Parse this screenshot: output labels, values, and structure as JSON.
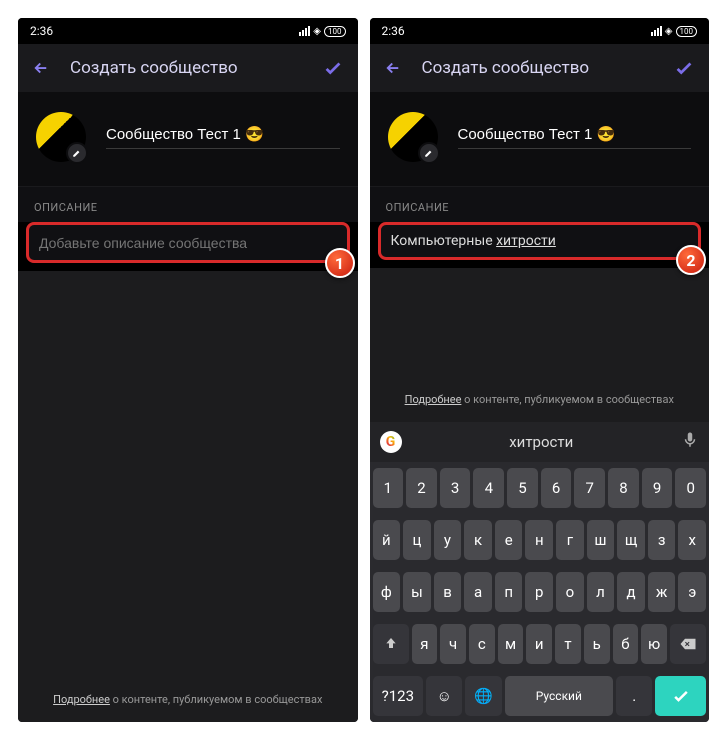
{
  "status": {
    "time": "2:36",
    "battery": "100"
  },
  "header": {
    "title": "Создать сообщество"
  },
  "community": {
    "name": "Сообщество Тест 1 😎"
  },
  "description": {
    "label": "ОПИСАНИЕ",
    "placeholder": "Добавьте описание сообщества",
    "value_prefix": "Компьютерные ",
    "value_underlined": "хитрости"
  },
  "badges": {
    "left": "1",
    "right": "2"
  },
  "footnote": {
    "link": "Подробнее",
    "text": " о контенте, публикуемом в сообществах"
  },
  "keyboard": {
    "suggestion": "хитрости",
    "row1": [
      "1",
      "2",
      "3",
      "4",
      "5",
      "6",
      "7",
      "8",
      "9",
      "0"
    ],
    "row2": [
      "й",
      "ц",
      "у",
      "к",
      "е",
      "н",
      "г",
      "ш",
      "щ",
      "з",
      "х"
    ],
    "row3": [
      "ф",
      "ы",
      "в",
      "а",
      "п",
      "р",
      "о",
      "л",
      "д",
      "ж",
      "э"
    ],
    "row4_letters": [
      "я",
      "ч",
      "с",
      "м",
      "и",
      "т",
      "ь",
      "б",
      "ю"
    ],
    "bottom": {
      "numkey": "?123",
      "lang": "Русский"
    }
  }
}
